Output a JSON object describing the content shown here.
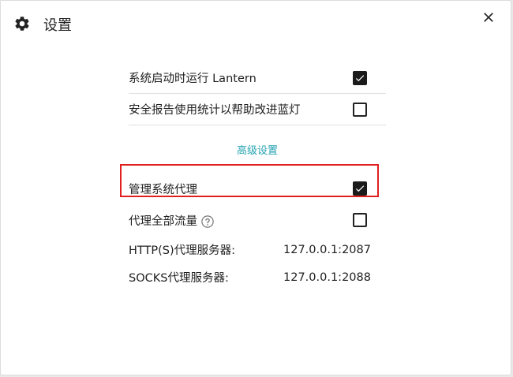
{
  "dialog": {
    "title": "设置",
    "icons": {
      "settings": "gear-icon",
      "close": "close-icon",
      "help": "help-circle-icon"
    }
  },
  "settings": {
    "launch_at_startup": {
      "label": "系统启动时运行 Lantern",
      "checked": true
    },
    "send_statistics": {
      "label": "安全报告使用统计以帮助改进蓝灯",
      "checked": false
    }
  },
  "advanced": {
    "link_label": "高级设置",
    "link_color": "#26a3b2",
    "manage_system_proxy": {
      "label": "管理系统代理",
      "checked": true,
      "highlight_color": "#e01f1f"
    },
    "proxy_all_traffic": {
      "label": "代理全部流量",
      "checked": false
    },
    "http_proxy": {
      "label": "HTTP(S)代理服务器:",
      "value": "127.0.0.1:2087"
    },
    "socks_proxy": {
      "label": "SOCKS代理服务器:",
      "value": "127.0.0.1:2088"
    }
  }
}
